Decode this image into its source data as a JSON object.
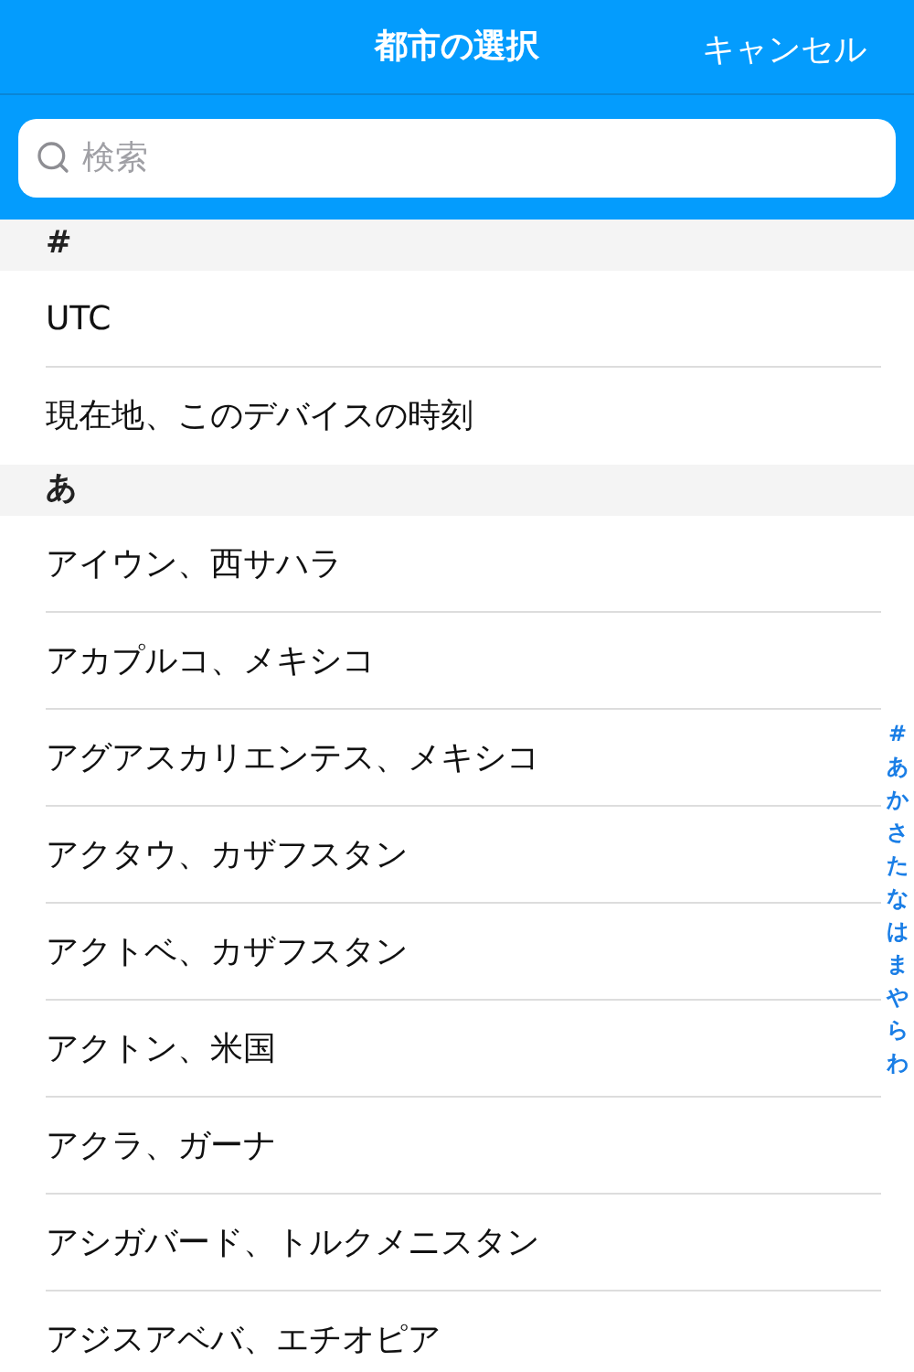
{
  "nav": {
    "title": "都市の選択",
    "cancel": "キャンセル"
  },
  "search": {
    "placeholder": "検索"
  },
  "sections": [
    {
      "header": "#",
      "rows": [
        "UTC",
        "現在地、このデバイスの時刻"
      ]
    },
    {
      "header": "あ",
      "rows": [
        "アイウン、西サハラ",
        "アカプルコ、メキシコ",
        "アグアスカリエンテス、メキシコ",
        "アクタウ、カザフスタン",
        "アクトベ、カザフスタン",
        "アクトン、米国",
        "アクラ、ガーナ",
        "アシガバード、トルクメニスタン",
        "アジスアベバ、エチオピア"
      ]
    }
  ],
  "index": [
    "#",
    "あ",
    "か",
    "さ",
    "た",
    "な",
    "は",
    "ま",
    "や",
    "ら",
    "わ"
  ]
}
